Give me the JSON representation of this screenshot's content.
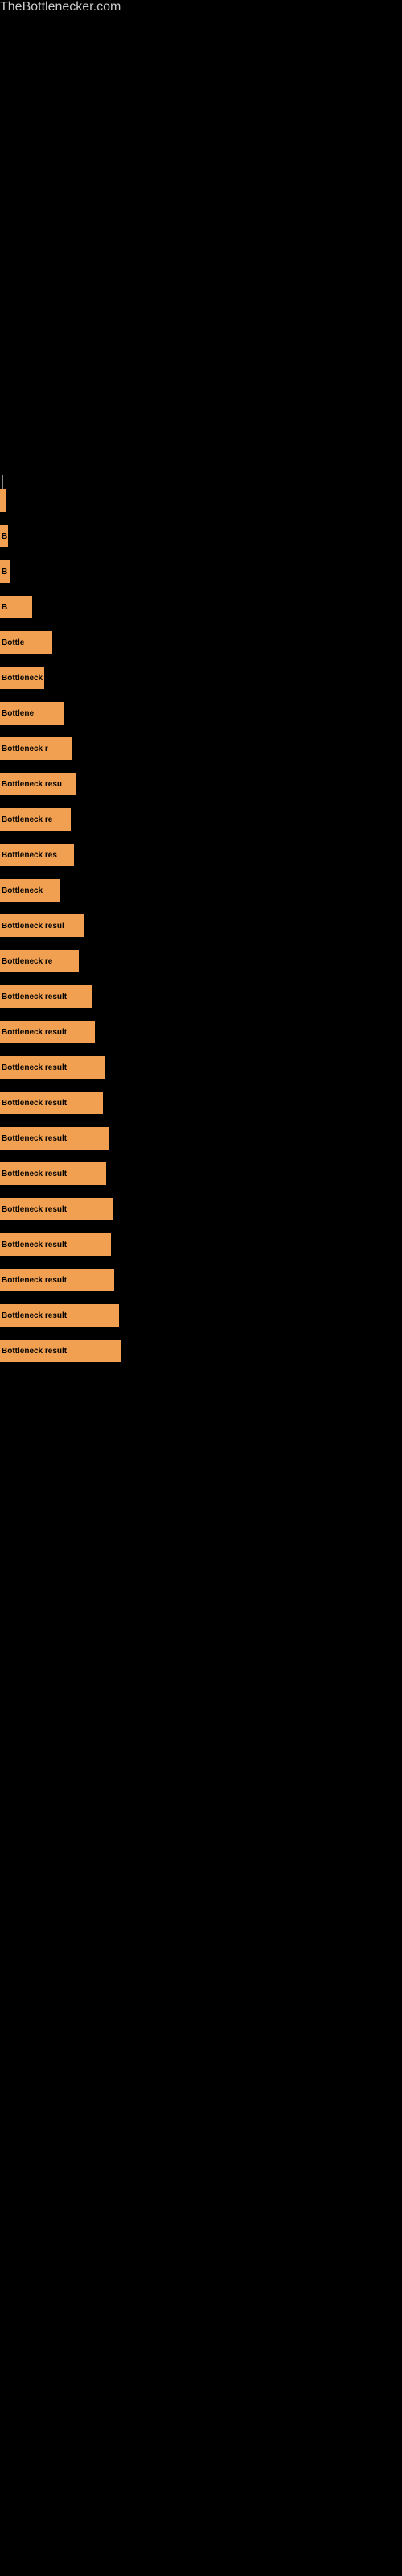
{
  "site": {
    "title": "TheBottlenecker.com"
  },
  "bars": [
    {
      "id": 1,
      "label": "",
      "width": 8,
      "text": ""
    },
    {
      "id": 2,
      "label": "",
      "width": 10,
      "text": "B"
    },
    {
      "id": 3,
      "label": "",
      "width": 12,
      "text": "B"
    },
    {
      "id": 4,
      "label": "",
      "width": 40,
      "text": "B"
    },
    {
      "id": 5,
      "label": "",
      "width": 65,
      "text": "Bottle"
    },
    {
      "id": 6,
      "label": "",
      "width": 55,
      "text": "Bottleneck"
    },
    {
      "id": 7,
      "label": "",
      "width": 80,
      "text": "Bottlene"
    },
    {
      "id": 8,
      "label": "",
      "width": 90,
      "text": "Bottleneck r"
    },
    {
      "id": 9,
      "label": "",
      "width": 95,
      "text": "Bottleneck resu"
    },
    {
      "id": 10,
      "label": "",
      "width": 88,
      "text": "Bottleneck re"
    },
    {
      "id": 11,
      "label": "",
      "width": 92,
      "text": "Bottleneck res"
    },
    {
      "id": 12,
      "label": "",
      "width": 75,
      "text": "Bottleneck"
    },
    {
      "id": 13,
      "label": "",
      "width": 105,
      "text": "Bottleneck resul"
    },
    {
      "id": 14,
      "label": "",
      "width": 98,
      "text": "Bottleneck re"
    },
    {
      "id": 15,
      "label": "",
      "width": 115,
      "text": "Bottleneck result"
    },
    {
      "id": 16,
      "label": "",
      "width": 118,
      "text": "Bottleneck result"
    },
    {
      "id": 17,
      "label": "",
      "width": 130,
      "text": "Bottleneck result"
    },
    {
      "id": 18,
      "label": "",
      "width": 128,
      "text": "Bottleneck result"
    },
    {
      "id": 19,
      "label": "",
      "width": 135,
      "text": "Bottleneck result"
    },
    {
      "id": 20,
      "label": "",
      "width": 132,
      "text": "Bottleneck result"
    },
    {
      "id": 21,
      "label": "",
      "width": 140,
      "text": "Bottleneck result"
    },
    {
      "id": 22,
      "label": "",
      "width": 138,
      "text": "Bottleneck result"
    },
    {
      "id": 23,
      "label": "",
      "width": 142,
      "text": "Bottleneck result"
    },
    {
      "id": 24,
      "label": "",
      "width": 148,
      "text": "Bottleneck result"
    },
    {
      "id": 25,
      "label": "",
      "width": 150,
      "text": "Bottleneck result"
    }
  ]
}
